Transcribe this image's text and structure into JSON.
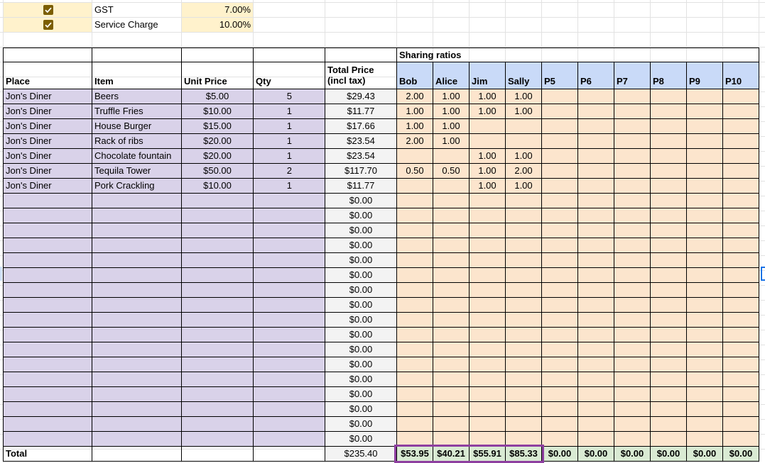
{
  "settings": {
    "rows": [
      {
        "checked": true,
        "label": "GST",
        "value": "7.00%"
      },
      {
        "checked": true,
        "label": "Service Charge",
        "value": "10.00%"
      }
    ]
  },
  "sharing_header": "Sharing ratios",
  "headers": {
    "place": "Place",
    "item": "Item",
    "unit_price": "Unit Price",
    "qty": "Qty",
    "total_line1": "Total Price",
    "total_line2": "(incl tax)",
    "people": [
      "Bob",
      "Alice",
      "Jim",
      "Sally",
      "P5",
      "P6",
      "P7",
      "P8",
      "P9",
      "P10"
    ]
  },
  "items": [
    {
      "place": "Jon's Diner",
      "item": "Beers",
      "unit": "$5.00",
      "qty": "5",
      "total": "$29.43",
      "ratios": [
        "2.00",
        "1.00",
        "1.00",
        "1.00",
        "",
        "",
        "",
        "",
        "",
        ""
      ]
    },
    {
      "place": "Jon's Diner",
      "item": "Truffle Fries",
      "unit": "$10.00",
      "qty": "1",
      "total": "$11.77",
      "ratios": [
        "1.00",
        "1.00",
        "1.00",
        "1.00",
        "",
        "",
        "",
        "",
        "",
        ""
      ]
    },
    {
      "place": "Jon's Diner",
      "item": "House Burger",
      "unit": "$15.00",
      "qty": "1",
      "total": "$17.66",
      "ratios": [
        "1.00",
        "1.00",
        "",
        "",
        "",
        "",
        "",
        "",
        "",
        ""
      ]
    },
    {
      "place": "Jon's Diner",
      "item": "Rack of ribs",
      "unit": "$20.00",
      "qty": "1",
      "total": "$23.54",
      "ratios": [
        "2.00",
        "1.00",
        "",
        "",
        "",
        "",
        "",
        "",
        "",
        ""
      ]
    },
    {
      "place": "Jon's Diner",
      "item": "Chocolate fountain",
      "unit": "$20.00",
      "qty": "1",
      "total": "$23.54",
      "ratios": [
        "",
        "",
        "1.00",
        "1.00",
        "",
        "",
        "",
        "",
        "",
        ""
      ]
    },
    {
      "place": "Jon's Diner",
      "item": "Tequila Tower",
      "unit": "$50.00",
      "qty": "2",
      "total": "$117.70",
      "ratios": [
        "0.50",
        "0.50",
        "1.00",
        "2.00",
        "",
        "",
        "",
        "",
        "",
        ""
      ]
    },
    {
      "place": "Jon's Diner",
      "item": "Pork Crackling",
      "unit": "$10.00",
      "qty": "1",
      "total": "$11.77",
      "ratios": [
        "",
        "",
        "1.00",
        "1.00",
        "",
        "",
        "",
        "",
        "",
        ""
      ]
    },
    {
      "place": "",
      "item": "",
      "unit": "",
      "qty": "",
      "total": "$0.00",
      "ratios": [
        "",
        "",
        "",
        "",
        "",
        "",
        "",
        "",
        "",
        ""
      ]
    },
    {
      "place": "",
      "item": "",
      "unit": "",
      "qty": "",
      "total": "$0.00",
      "ratios": [
        "",
        "",
        "",
        "",
        "",
        "",
        "",
        "",
        "",
        ""
      ]
    },
    {
      "place": "",
      "item": "",
      "unit": "",
      "qty": "",
      "total": "$0.00",
      "ratios": [
        "",
        "",
        "",
        "",
        "",
        "",
        "",
        "",
        "",
        ""
      ]
    },
    {
      "place": "",
      "item": "",
      "unit": "",
      "qty": "",
      "total": "$0.00",
      "ratios": [
        "",
        "",
        "",
        "",
        "",
        "",
        "",
        "",
        "",
        ""
      ]
    },
    {
      "place": "",
      "item": "",
      "unit": "",
      "qty": "",
      "total": "$0.00",
      "ratios": [
        "",
        "",
        "",
        "",
        "",
        "",
        "",
        "",
        "",
        ""
      ]
    },
    {
      "place": "",
      "item": "",
      "unit": "",
      "qty": "",
      "total": "$0.00",
      "ratios": [
        "",
        "",
        "",
        "",
        "",
        "",
        "",
        "",
        "",
        ""
      ]
    },
    {
      "place": "",
      "item": "",
      "unit": "",
      "qty": "",
      "total": "$0.00",
      "ratios": [
        "",
        "",
        "",
        "",
        "",
        "",
        "",
        "",
        "",
        ""
      ]
    },
    {
      "place": "",
      "item": "",
      "unit": "",
      "qty": "",
      "total": "$0.00",
      "ratios": [
        "",
        "",
        "",
        "",
        "",
        "",
        "",
        "",
        "",
        ""
      ]
    },
    {
      "place": "",
      "item": "",
      "unit": "",
      "qty": "",
      "total": "$0.00",
      "ratios": [
        "",
        "",
        "",
        "",
        "",
        "",
        "",
        "",
        "",
        ""
      ]
    },
    {
      "place": "",
      "item": "",
      "unit": "",
      "qty": "",
      "total": "$0.00",
      "ratios": [
        "",
        "",
        "",
        "",
        "",
        "",
        "",
        "",
        "",
        ""
      ]
    },
    {
      "place": "",
      "item": "",
      "unit": "",
      "qty": "",
      "total": "$0.00",
      "ratios": [
        "",
        "",
        "",
        "",
        "",
        "",
        "",
        "",
        "",
        ""
      ]
    },
    {
      "place": "",
      "item": "",
      "unit": "",
      "qty": "",
      "total": "$0.00",
      "ratios": [
        "",
        "",
        "",
        "",
        "",
        "",
        "",
        "",
        "",
        ""
      ]
    },
    {
      "place": "",
      "item": "",
      "unit": "",
      "qty": "",
      "total": "$0.00",
      "ratios": [
        "",
        "",
        "",
        "",
        "",
        "",
        "",
        "",
        "",
        ""
      ]
    },
    {
      "place": "",
      "item": "",
      "unit": "",
      "qty": "",
      "total": "$0.00",
      "ratios": [
        "",
        "",
        "",
        "",
        "",
        "",
        "",
        "",
        "",
        ""
      ]
    },
    {
      "place": "",
      "item": "",
      "unit": "",
      "qty": "",
      "total": "$0.00",
      "ratios": [
        "",
        "",
        "",
        "",
        "",
        "",
        "",
        "",
        "",
        ""
      ]
    },
    {
      "place": "",
      "item": "",
      "unit": "",
      "qty": "",
      "total": "$0.00",
      "ratios": [
        "",
        "",
        "",
        "",
        "",
        "",
        "",
        "",
        "",
        ""
      ]
    },
    {
      "place": "",
      "item": "",
      "unit": "",
      "qty": "",
      "total": "$0.00",
      "ratios": [
        "",
        "",
        "",
        "",
        "",
        "",
        "",
        "",
        "",
        ""
      ]
    }
  ],
  "totals": {
    "label": "Total",
    "grand_total": "$235.40",
    "per_person": [
      "$53.95",
      "$40.21",
      "$55.91",
      "$85.33",
      "$0.00",
      "$0.00",
      "$0.00",
      "$0.00",
      "$0.00",
      "$0.00"
    ]
  },
  "colors": {
    "input_purple": "#d9d2e9",
    "settings_yellow": "#fff2cc",
    "ratio_orange": "#fce5cd",
    "people_header_blue": "#c9daf8",
    "per_person_green": "#d9ead3",
    "total_col_gray": "#f3f3f3",
    "highlight_border": "#8e3fa0",
    "checkbox": "#7b5e00"
  }
}
